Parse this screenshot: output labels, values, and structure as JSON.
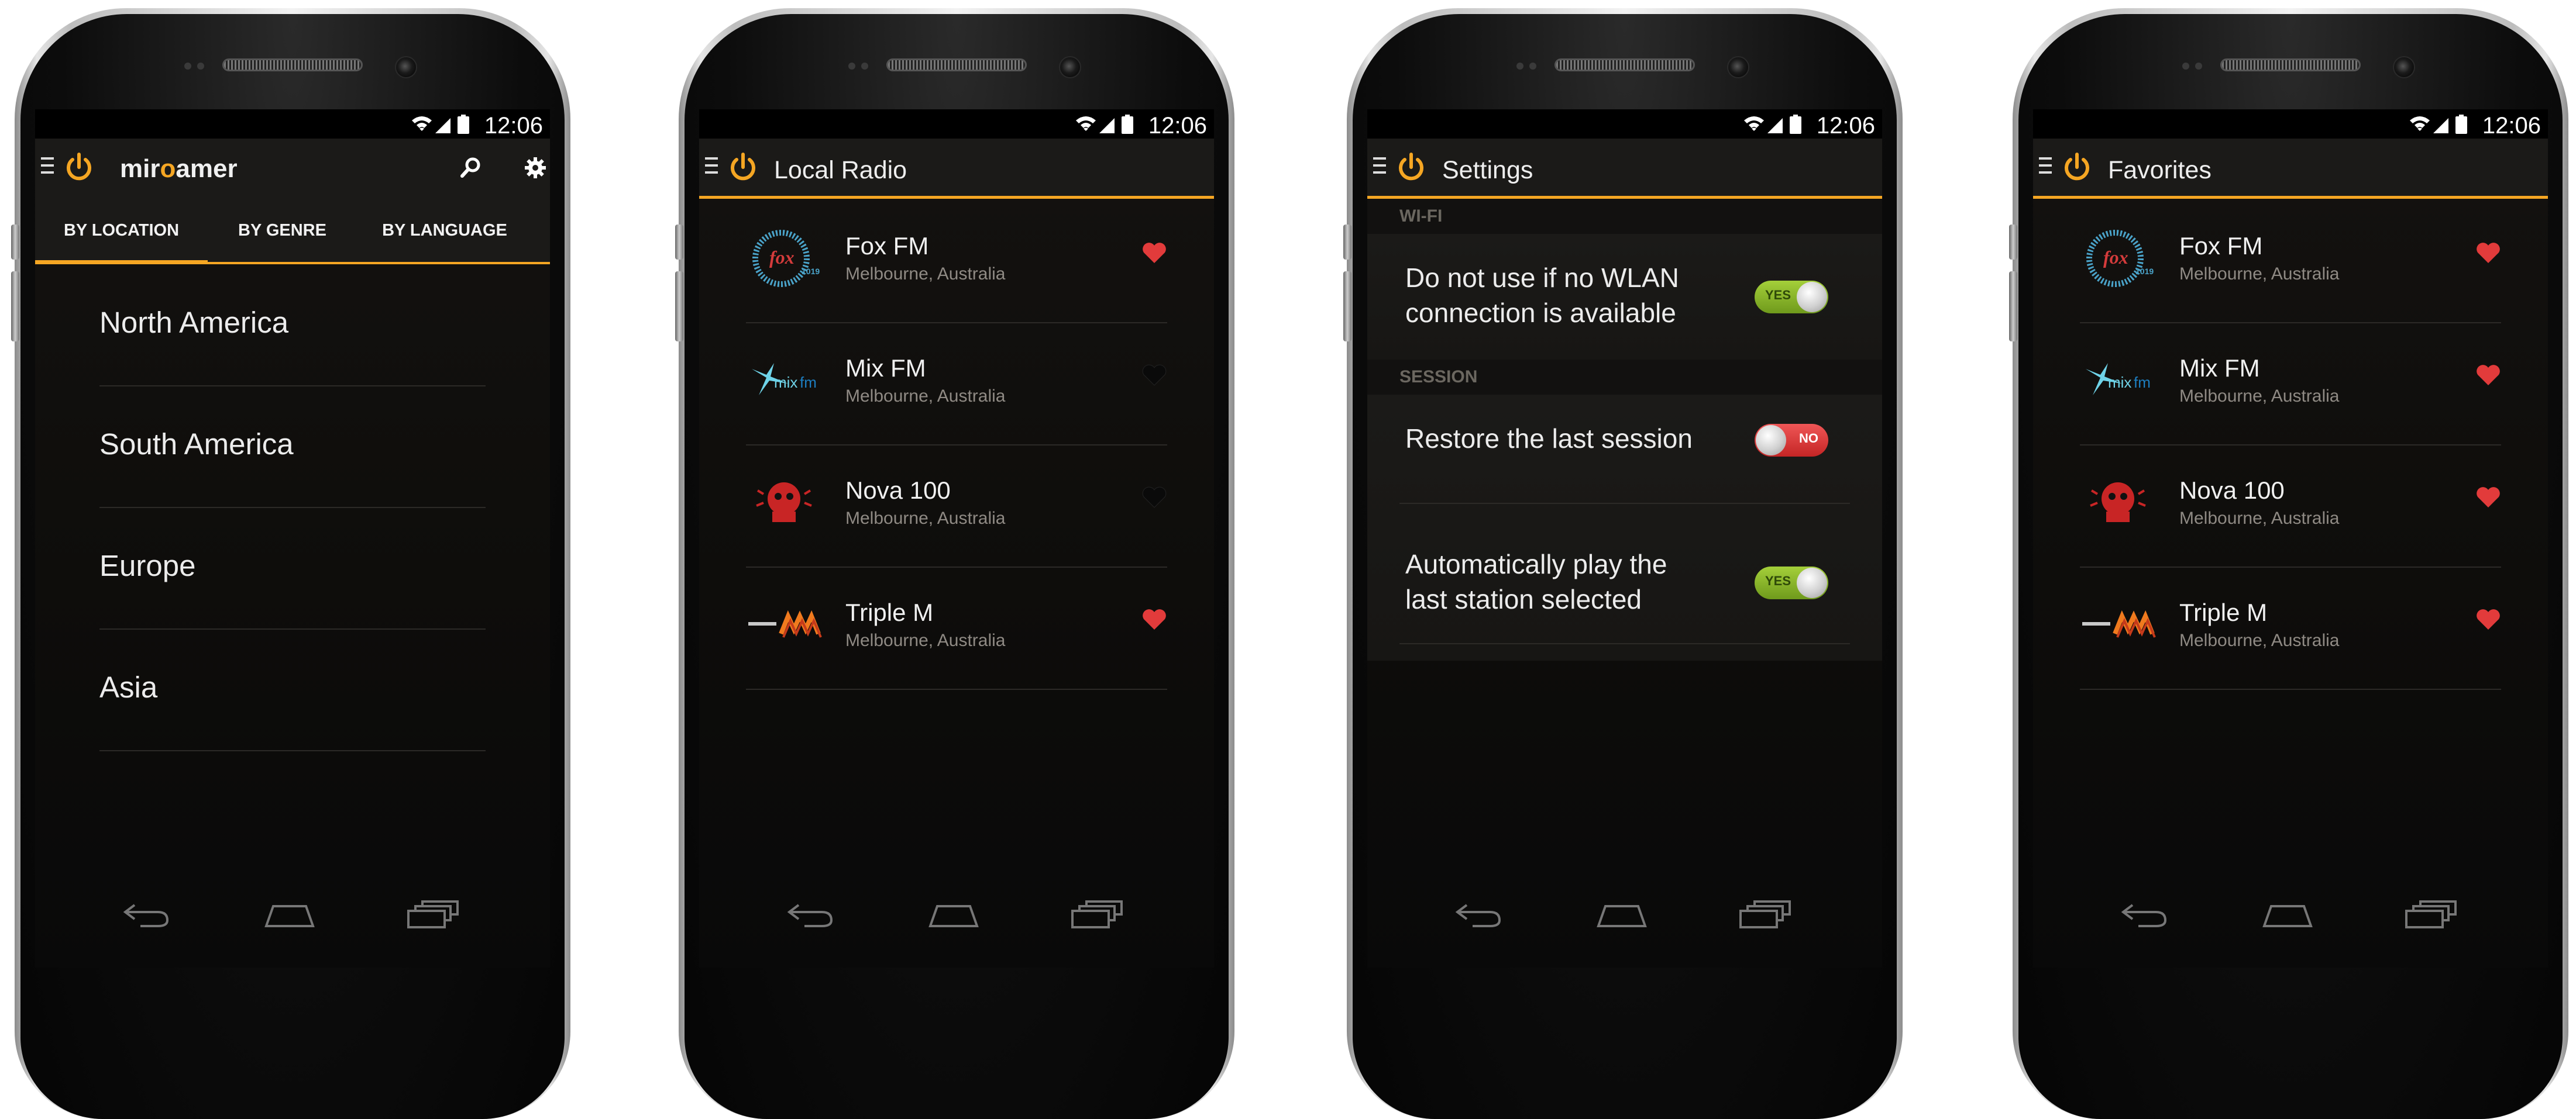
{
  "status_bar": {
    "time": "12:06"
  },
  "screens": {
    "home": {
      "brand": {
        "prefix": "mir",
        "o": "o",
        "suffix": "amer"
      },
      "tabs": [
        "BY LOCATION",
        "BY GENRE",
        "BY LANGUAGE"
      ],
      "selected_tab": 0,
      "locations": [
        "North America",
        "South America",
        "Europe",
        "Asia"
      ],
      "icons": [
        "menu-icon",
        "power-icon",
        "search-icon",
        "gear-icon"
      ]
    },
    "local_radio": {
      "title": "Local Radio",
      "stations": [
        {
          "name": "Fox FM",
          "location": "Melbourne, Australia",
          "favorite": true
        },
        {
          "name": "Mix FM",
          "location": "Melbourne, Australia",
          "favorite": false
        },
        {
          "name": "Nova 100",
          "location": "Melbourne, Australia",
          "favorite": false
        },
        {
          "name": "Triple M",
          "location": "Melbourne, Australia",
          "favorite": true
        }
      ]
    },
    "settings": {
      "title": "Settings",
      "sections": [
        {
          "header": "WI-FI",
          "items": [
            {
              "label_line1": "Do not use if no WLAN",
              "label_line2": "connection is available",
              "value": true,
              "toggle_text": "YES"
            }
          ]
        },
        {
          "header": "SESSION",
          "items": [
            {
              "label_line1": "Restore the last session",
              "label_line2": "",
              "value": false,
              "toggle_text": "NO"
            },
            {
              "label_line1": "Automatically play the",
              "label_line2": "last station selected",
              "value": true,
              "toggle_text": "YES"
            }
          ]
        }
      ]
    },
    "favorites": {
      "title": "Favorites",
      "stations": [
        {
          "name": "Fox FM",
          "location": "Melbourne, Australia",
          "favorite": true
        },
        {
          "name": "Mix FM",
          "location": "Melbourne, Australia",
          "favorite": true
        },
        {
          "name": "Nova 100",
          "location": "Melbourne, Australia",
          "favorite": true
        },
        {
          "name": "Triple M",
          "location": "Melbourne, Australia",
          "favorite": true
        }
      ]
    }
  },
  "colors": {
    "accent": "#f5a623",
    "heart_on": "#e23b3b",
    "heart_off": "#0a0a0a",
    "toggle_yes": "#8fbf2e",
    "toggle_no": "#e03a3a"
  },
  "nav_icons": [
    "back-icon",
    "home-icon",
    "recent-apps-icon"
  ]
}
